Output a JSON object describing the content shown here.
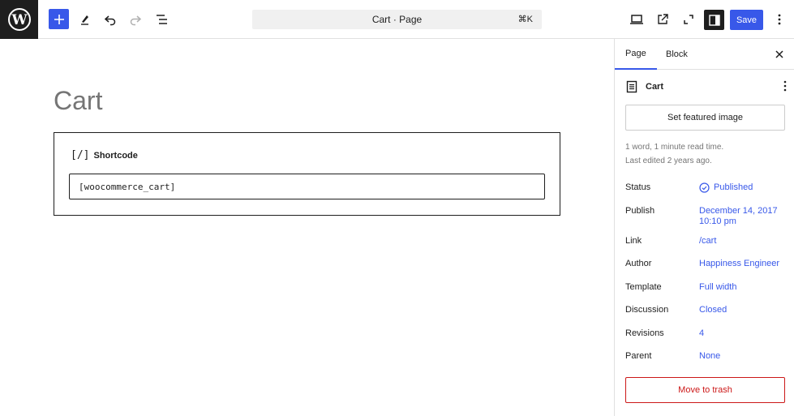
{
  "toolbar": {
    "command_title": "Cart · Page",
    "command_shortcut": "⌘K",
    "save_label": "Save"
  },
  "editor": {
    "page_title": "Cart",
    "block_label": "Shortcode",
    "block_glyph": "[/]",
    "shortcode_value": "[woocommerce_cart]"
  },
  "sidebar": {
    "tabs": [
      {
        "label": "Page"
      },
      {
        "label": "Block"
      }
    ],
    "doc_title": "Cart",
    "featured_label": "Set featured image",
    "read_time": "1 word, 1 minute read time.",
    "last_edited": "Last edited 2 years ago.",
    "rows": [
      {
        "key": "Status",
        "value": "Published"
      },
      {
        "key": "Publish",
        "value": "December 14, 2017 10:10 pm"
      },
      {
        "key": "Link",
        "value": "/cart"
      },
      {
        "key": "Author",
        "value": "Happiness Engineer"
      },
      {
        "key": "Template",
        "value": "Full width"
      },
      {
        "key": "Discussion",
        "value": "Closed"
      },
      {
        "key": "Revisions",
        "value": "4"
      },
      {
        "key": "Parent",
        "value": "None"
      }
    ],
    "trash_label": "Move to trash"
  },
  "colors": {
    "accent": "#3858e9",
    "danger": "#cc1818",
    "dark": "#1e1e1e"
  },
  "icons": [
    "wordpress-logo-icon",
    "plus-icon",
    "pen-icon",
    "undo-icon",
    "redo-icon",
    "list-view-icon",
    "desktop-icon",
    "external-link-icon",
    "fullscreen-icon",
    "sidebar-icon",
    "more-vertical-icon",
    "close-icon",
    "page-icon",
    "check-circle-icon"
  ]
}
